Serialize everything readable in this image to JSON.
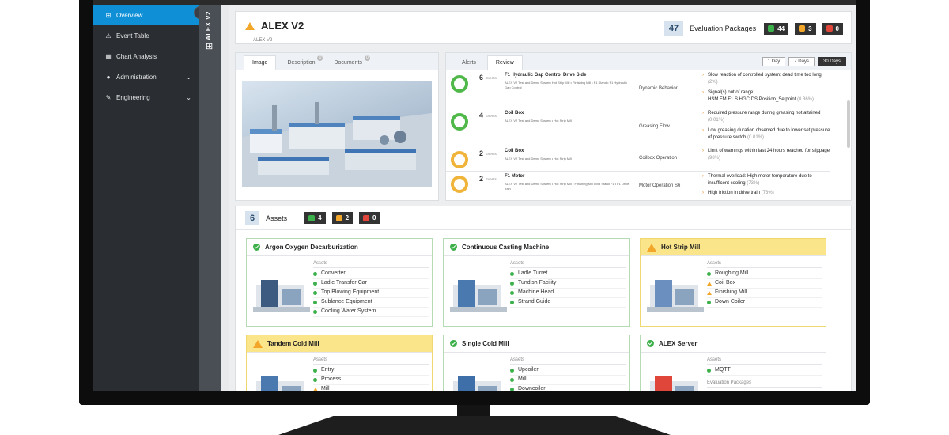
{
  "nav": {
    "items": [
      {
        "label": "Overview",
        "icon": "sitemap-icon",
        "active": true,
        "chevron": false
      },
      {
        "label": "Event Table",
        "icon": "warning-icon",
        "active": false,
        "chevron": false
      },
      {
        "label": "Chart Analysis",
        "icon": "chart-icon",
        "active": false,
        "chevron": false
      },
      {
        "label": "Administration",
        "icon": "palette-icon",
        "active": false,
        "chevron": true
      },
      {
        "label": "Engineering",
        "icon": "wrench-icon",
        "active": false,
        "chevron": true
      }
    ],
    "collapse_icon": "chevron-left-icon",
    "vertical_label": "ALEX V2"
  },
  "header": {
    "title": "ALEX V2",
    "subtitle": "ALEX V2",
    "eval_count": "47",
    "eval_label": "Evaluation Packages",
    "ok_count": "44",
    "warn_count": "3",
    "alert_count": "0"
  },
  "image_panel": {
    "tabs": [
      "Image",
      "Description",
      "Documents"
    ],
    "tab_badges": [
      "",
      "0",
      "0"
    ]
  },
  "alerts_panel": {
    "tabs": [
      "Alerts",
      "Review"
    ],
    "ranges": [
      "1 Day",
      "7 Days",
      "30 Days"
    ],
    "events_label": "Events",
    "rows": [
      {
        "count": "6",
        "name": "F1 Hydraulic Gap Control Drive Side",
        "desc": "ALEX V2 Test and Demo System Hot Strip Mill  •  Finishing Mill  •  F1 Stand  •  F1 Hydraulic Gap Control",
        "type": "Dynamic Behavior",
        "ring": "#4fb848",
        "msgs": [
          {
            "text": "Slow reaction of controlled system: dead time too long",
            "pct": "(2%)"
          },
          {
            "text": "Signal(s) out of range: HSM.FM.F1.S.HGC.DS.Position_Setpoint",
            "pct": "(0.36%)"
          }
        ]
      },
      {
        "count": "4",
        "name": "Coil Box",
        "desc": "ALEX V2 Test and Demo System  •  Hot Strip Mill",
        "type": "Greasing Flow",
        "ring": "#4fb848",
        "msgs": [
          {
            "text": "Required pressure range during greasing not attained",
            "pct": "(0.01%)"
          },
          {
            "text": "Low greasing duration observed due to lower set pressure of pressure switch",
            "pct": "(0.01%)"
          }
        ]
      },
      {
        "count": "2",
        "name": "Coil Box",
        "desc": "ALEX V2 Test and Demo System  •  Hot Strip Mill",
        "type": "Coilbox Operation",
        "ring": "#f0b43a",
        "msgs": [
          {
            "text": "Limit of warnings within last 24 hours reached for slippage",
            "pct": "(98%)"
          }
        ]
      },
      {
        "count": "2",
        "name": "F1 Motor",
        "desc": "ALEX V2 Test and Demo System  •  Hot Strip Mill  •  Finishing Mill  •  Mill Stand F1  •  F1 Drive train",
        "type": "Motor Operation S6",
        "ring": "#f0b43a",
        "msgs": [
          {
            "text": "Thermal overload: High motor temperature due to insufficent cooling",
            "pct": "(73%)"
          },
          {
            "text": "High friction in drive train",
            "pct": "(73%)"
          }
        ]
      }
    ]
  },
  "assets": {
    "count": "6",
    "label": "Assets",
    "ok_count": "4",
    "warn_count": "2",
    "alert_count": "0",
    "list_label": "Assets",
    "cards": [
      {
        "title": "Argon Oxygen Decarburization",
        "status": "ok",
        "items": [
          {
            "t": "Converter",
            "s": "ok"
          },
          {
            "t": "Ladle Transfer Car",
            "s": "ok"
          },
          {
            "t": "Top Blowing Equipment",
            "s": "ok"
          },
          {
            "t": "Sublance Equipment",
            "s": "ok"
          },
          {
            "t": "Cooling Water System",
            "s": "ok"
          }
        ]
      },
      {
        "title": "Continuous Casting Machine",
        "status": "ok",
        "items": [
          {
            "t": "Ladle Turret",
            "s": "ok"
          },
          {
            "t": "Tundish Facility",
            "s": "ok"
          },
          {
            "t": "Machine Head",
            "s": "ok"
          },
          {
            "t": "Strand Guide",
            "s": "ok"
          }
        ]
      },
      {
        "title": "Hot Strip Mill",
        "status": "warn",
        "items": [
          {
            "t": "Roughing Mill",
            "s": "ok"
          },
          {
            "t": "Coil Box",
            "s": "warn"
          },
          {
            "t": "Finishing Mill",
            "s": "warn"
          },
          {
            "t": "Down Coiler",
            "s": "ok"
          }
        ]
      },
      {
        "title": "Tandem Cold Mill",
        "status": "warn",
        "items": [
          {
            "t": "Entry",
            "s": "ok"
          },
          {
            "t": "Process",
            "s": "ok"
          },
          {
            "t": "Mill",
            "s": "warn"
          }
        ]
      },
      {
        "title": "Single Cold Mill",
        "status": "ok",
        "items": [
          {
            "t": "Upcoiler",
            "s": "ok"
          },
          {
            "t": "Mill",
            "s": "ok"
          },
          {
            "t": "Downcoiler",
            "s": "ok"
          }
        ]
      },
      {
        "title": "ALEX Server",
        "status": "ok",
        "items": [
          {
            "t": "MQTT",
            "s": "ok"
          }
        ],
        "extra_label": "Evaluation Packages"
      }
    ]
  },
  "colors": {
    "accent": "#0e8fd6",
    "ok": "#3cb04a",
    "warn": "#f2a72b",
    "alert": "#e0463a"
  }
}
